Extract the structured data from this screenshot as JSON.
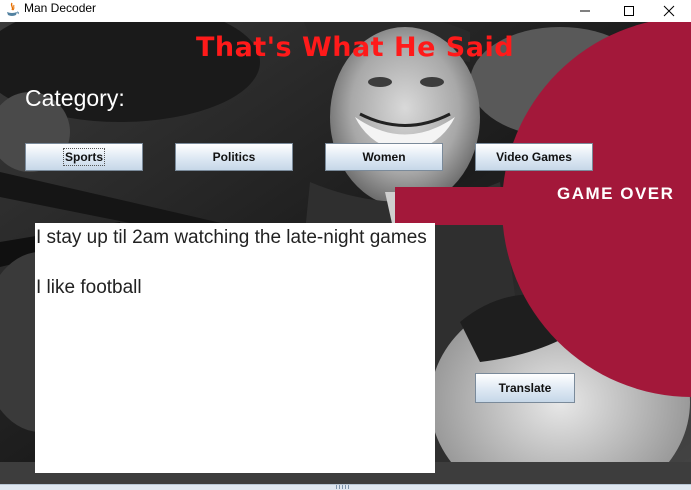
{
  "window": {
    "title": "Man Decoder",
    "app_icon": "java-icon"
  },
  "header": {
    "title": "That's What He Said"
  },
  "category": {
    "label": "Category:",
    "buttons": [
      "Sports",
      "Politics",
      "Women",
      "Video Games"
    ],
    "focused": "Sports"
  },
  "banner": {
    "text": "GAME OVER",
    "color": "#a3183a"
  },
  "output": {
    "text": "I stay up til 2am watching the late-night games\n\nI like football"
  },
  "translate_label": "Translate",
  "colors": {
    "title_red": "#ff1a1a",
    "banner": "#a3183a"
  }
}
